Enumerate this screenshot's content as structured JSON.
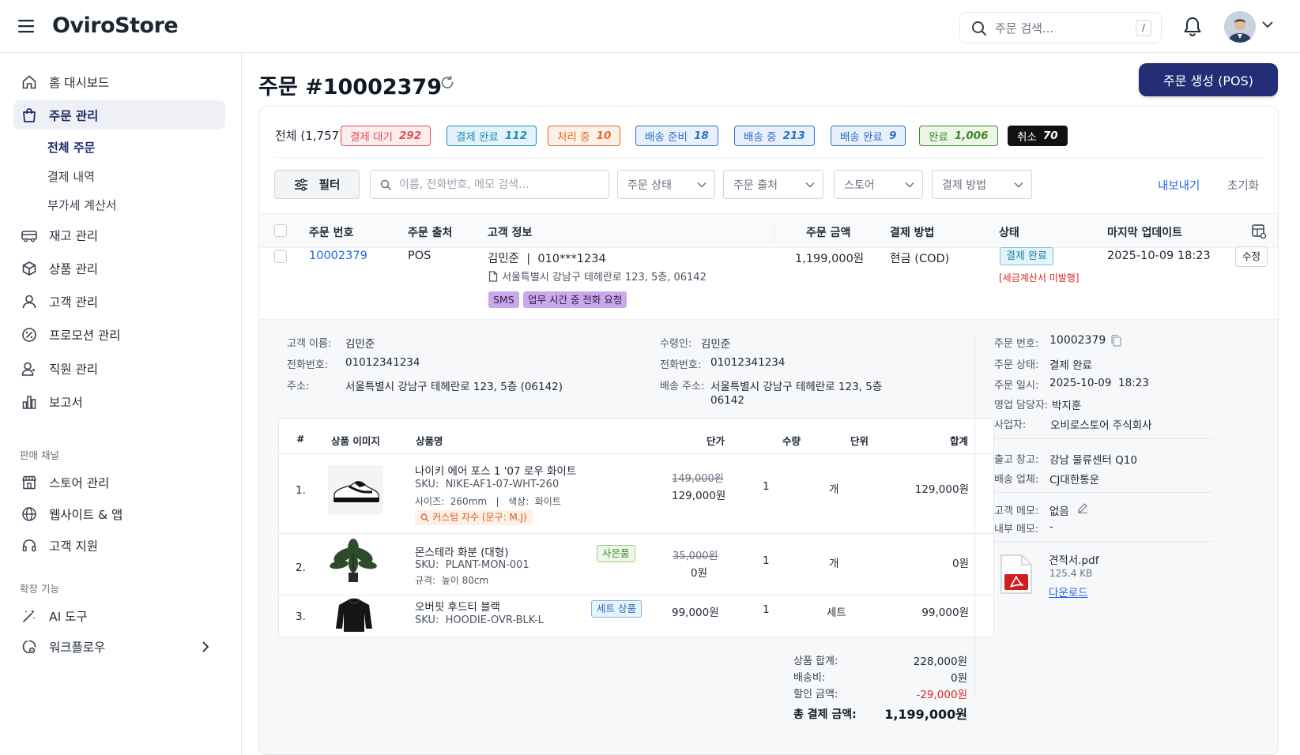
{
  "brand": "OviroStore",
  "search": {
    "placeholder": "주문 검색...",
    "shortcut": "/"
  },
  "sidebar": {
    "items": [
      {
        "label": "홈 대시보드"
      },
      {
        "label": "주문 관리"
      },
      {
        "label": "재고 관리"
      },
      {
        "label": "상품 관리"
      },
      {
        "label": "고객 관리"
      },
      {
        "label": "프로모션 관리"
      },
      {
        "label": "직원 관리"
      },
      {
        "label": "보고서"
      }
    ],
    "subitems": [
      "전체 주문",
      "결제 내역",
      "부가세 계산서"
    ],
    "section_sales": "판매 채널",
    "sales_items": [
      {
        "label": "스토어 관리"
      },
      {
        "label": "웹사이트 & 앱"
      },
      {
        "label": "고객 지원"
      }
    ],
    "section_ext": "확장 기능",
    "ext_items": [
      {
        "label": "AI 도구"
      },
      {
        "label": "워크플로우"
      }
    ]
  },
  "page": {
    "title": "주문 #10002379",
    "pos_button": "주문 생성 (POS)"
  },
  "statuses": {
    "all_label": "전체 (1,757)",
    "pills": [
      {
        "label": "결제 대기",
        "count": "292",
        "color": "#e0505a"
      },
      {
        "label": "결제 완료",
        "count": "112",
        "color": "#1f8fb5"
      },
      {
        "label": "처리 중",
        "count": "10",
        "color": "#e66a2c"
      },
      {
        "label": "배송 준비",
        "count": "18",
        "color": "#2f6fc8"
      },
      {
        "label": "배송 중",
        "count": "213",
        "color": "#2f6fc8"
      },
      {
        "label": "배송 완료",
        "count": "9",
        "color": "#2f6fc8"
      },
      {
        "label": "완료",
        "count": "1,006",
        "color": "#3f8a2a"
      },
      {
        "label": "취소",
        "count": "70",
        "color": "#000000"
      }
    ]
  },
  "filters": {
    "filter_button": "필터",
    "search_placeholder": "이름, 전화번호, 메모 검색...",
    "dropdowns": [
      "주문 상태",
      "주문 출처",
      "스토어",
      "결제 방법"
    ],
    "export": "내보내기",
    "reset": "초기화"
  },
  "table": {
    "headers": [
      "주문 번호",
      "주문 출처",
      "고객 정보",
      "주문 금액",
      "결제 방법",
      "상태",
      "마지막 업데이트"
    ],
    "row": {
      "order_no": "10002379",
      "source": "POS",
      "customer": "김민준  |  010***1234",
      "address": "서울특별시 강남구 테헤란로 123, 5층, 06142",
      "tags": [
        "SMS",
        "업무 시간 중 전화 요청"
      ],
      "amount": "1,199,000원",
      "payment": "현금 (COD)",
      "status": "결제 완료",
      "status_note": "[세금계산서 미발행]",
      "updated": "2025-10-09 18:23",
      "edit": "수정"
    }
  },
  "detail": {
    "customer": [
      {
        "k": "고객 이름:",
        "v": "김민준"
      },
      {
        "k": "전화번호:",
        "v": "01012341234"
      },
      {
        "k": "주소:",
        "v": "서울특별시 강남구 테헤란로 123, 5층 (06142)"
      }
    ],
    "recipient": [
      {
        "k": "수령인:",
        "v": "김민준"
      },
      {
        "k": "전화번호:",
        "v": "01012341234"
      },
      {
        "k": "배송 주소:",
        "v": "서울특별시 강남구 테헤란로 123, 5층",
        "v2": "06142"
      }
    ],
    "items_headers": [
      "#",
      "상품 이미지",
      "상품명",
      "단가",
      "수량",
      "단위",
      "합계"
    ],
    "items": [
      {
        "no": "1.",
        "name": "나이키 에어 포스 1 '07 로우 화이트",
        "sku": "SKU:  NIKE-AF1-07-WHT-260",
        "spec": "사이즈:  260mm   |   색상:  화이트",
        "custom": "커스텀 자수 (문구: M.J)",
        "old_price": "149,000원",
        "price": "129,000원",
        "qty": "1",
        "unit": "개",
        "total": "129,000원"
      },
      {
        "no": "2.",
        "name": "몬스테라 화분 (대형)",
        "sku": "SKU:  PLANT-MON-001",
        "spec": "규격:  높이 80cm",
        "tag": "사은품",
        "old_price": "35,000원",
        "price": "0원",
        "qty": "1",
        "unit": "개",
        "total": "0원"
      },
      {
        "no": "3.",
        "name": "오버핏 후드티 블랙",
        "sku": "SKU:  HOODIE-OVR-BLK-L",
        "tag": "세트 상품",
        "price": "99,000원",
        "qty": "1",
        "unit": "세트",
        "total": "99,000원"
      }
    ],
    "totals": [
      {
        "k": "상품 합계:",
        "v": "228,000원"
      },
      {
        "k": "배송비:",
        "v": "0원"
      },
      {
        "k": "할인 금액:",
        "v": "-29,000원"
      },
      {
        "k": "총 결제 금액:",
        "v": "1,199,000원"
      }
    ],
    "order_info": [
      {
        "k": "주문 번호:",
        "v": "10002379"
      },
      {
        "k": "주문 상태:",
        "v": "결제 완료"
      },
      {
        "k": "주문 일시:",
        "v": "2025-10-09  18:23"
      },
      {
        "k": "영업 담당자:",
        "v": "박지훈"
      },
      {
        "k": "사업자:",
        "v": "오비로스토어 주식회사"
      }
    ],
    "logistics": [
      {
        "k": "출고 창고:",
        "v": "강남 물류센터 Q10"
      },
      {
        "k": "배송 업체:",
        "v": "CJ대한통운"
      }
    ],
    "memos": [
      {
        "k": "고객 메모:",
        "v": "없음"
      },
      {
        "k": "내부 메모:",
        "v": "-"
      }
    ],
    "file": {
      "name": "견적서.pdf",
      "size": "125.4 KB",
      "download": "다운로드"
    }
  }
}
